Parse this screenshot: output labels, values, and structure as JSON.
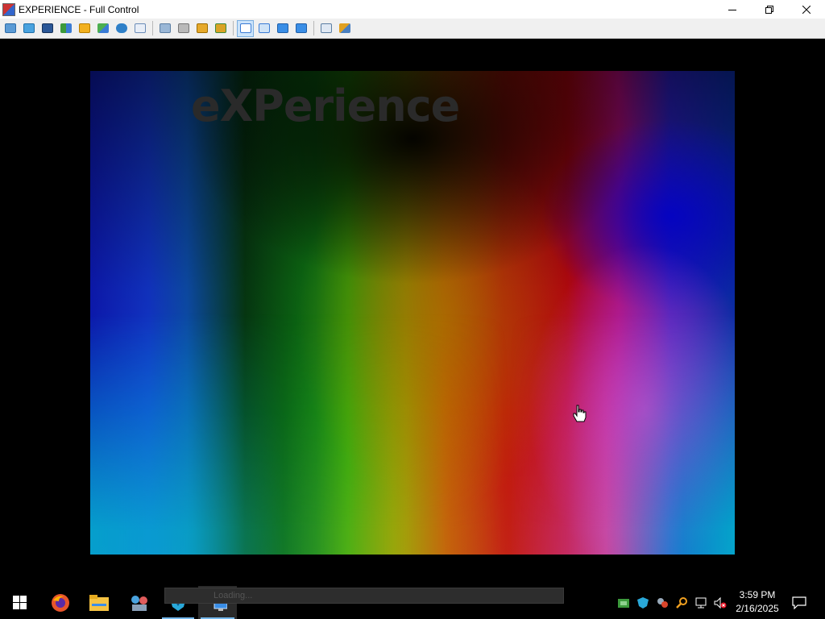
{
  "window": {
    "title": "EXPERIENCE - Full Control",
    "controls": {
      "minimize": "minimize-icon",
      "restore": "restore-icon",
      "close": "close-icon"
    }
  },
  "toolbar": {
    "groups": [
      [
        "capture-icon",
        "desktop-icon",
        "terminal-icon",
        "transfer-icon",
        "lock-icon",
        "chat-icon",
        "phone-icon",
        "message-icon"
      ],
      [
        "upload-icon",
        "network-icon",
        "lock-screen-icon",
        "unlock-icon"
      ],
      [
        "fit-window-icon",
        "stretch-icon",
        "actual-size-icon",
        "fullscreen-icon"
      ],
      [
        "multi-monitor-icon",
        "tools-icon"
      ]
    ],
    "active_icon": "fit-window-icon"
  },
  "remote_screen": {
    "splash_title": "eXPerience",
    "remote_taskbar_text": "Loading..."
  },
  "taskbar": {
    "start": "windows-start-icon",
    "apps": [
      "firefox-icon",
      "file-explorer-icon",
      "network-app-icon",
      "vpn-shield-icon",
      "remote-control-app-icon"
    ],
    "tray_icons": [
      "network-manager-icon",
      "vpn-tray-icon",
      "remote-tray-icon",
      "search-tray-icon",
      "network-status-icon",
      "volume-muted-icon"
    ],
    "time": "3:59 PM",
    "date": "2/16/2025",
    "notifications": "action-center-icon"
  },
  "colors": {
    "accent": "#76b9ed",
    "taskbar": "#000000",
    "titlebar": "#ffffff",
    "toolbar": "#f0f0f0"
  }
}
